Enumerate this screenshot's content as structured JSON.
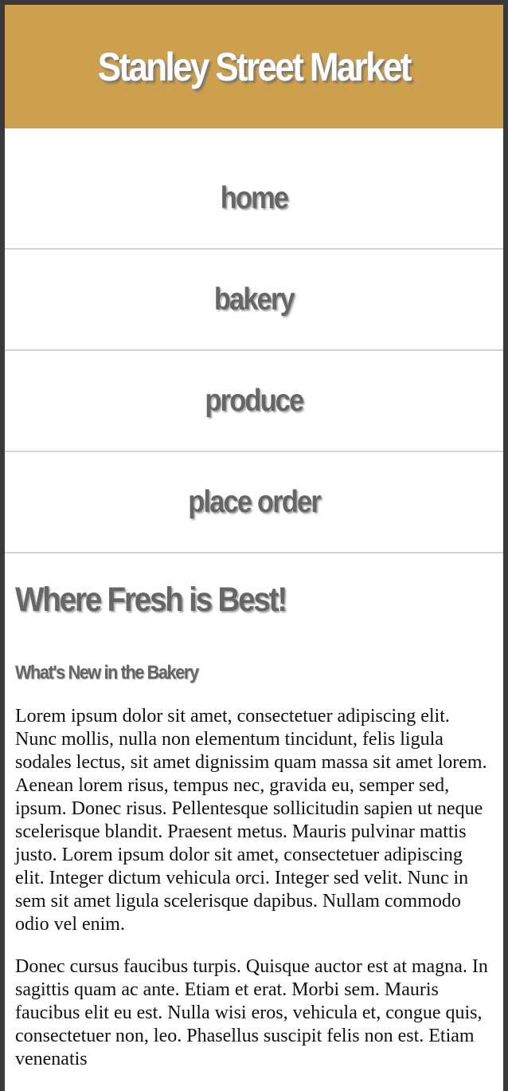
{
  "header": {
    "title": "Stanley Street Market",
    "background_color": "#cda04d"
  },
  "nav": {
    "items": [
      {
        "label": "home"
      },
      {
        "label": "bakery"
      },
      {
        "label": "produce"
      },
      {
        "label": "place order"
      }
    ]
  },
  "main": {
    "headline": "Where Fresh is Best!",
    "subhead": "What's New in the Bakery",
    "paragraphs": [
      "Lorem ipsum dolor sit amet, consectetuer adipiscing elit. Nunc mollis, nulla non elementum tincidunt, felis ligula sodales lectus, sit amet dignissim quam massa sit amet lorem. Aenean lorem risus, tempus nec, gravida eu, semper sed, ipsum. Donec risus. Pellentesque sollicitudin sapien ut neque scelerisque blandit. Praesent metus. Mauris pulvinar mattis justo. Lorem ipsum dolor sit amet, consectetuer adipiscing elit. Integer dictum vehicula orci. Integer sed velit. Nunc in sem sit amet ligula scelerisque dapibus. Nullam commodo odio vel enim.",
      "Donec cursus faucibus turpis. Quisque auctor est at magna. In sagittis quam ac ante. Etiam et erat. Morbi sem. Mauris faucibus elit eu est. Nulla wisi eros, vehicula et, congue quis, consectetuer non, leo. Phasellus suscipit felis non est. Etiam venenatis"
    ]
  }
}
